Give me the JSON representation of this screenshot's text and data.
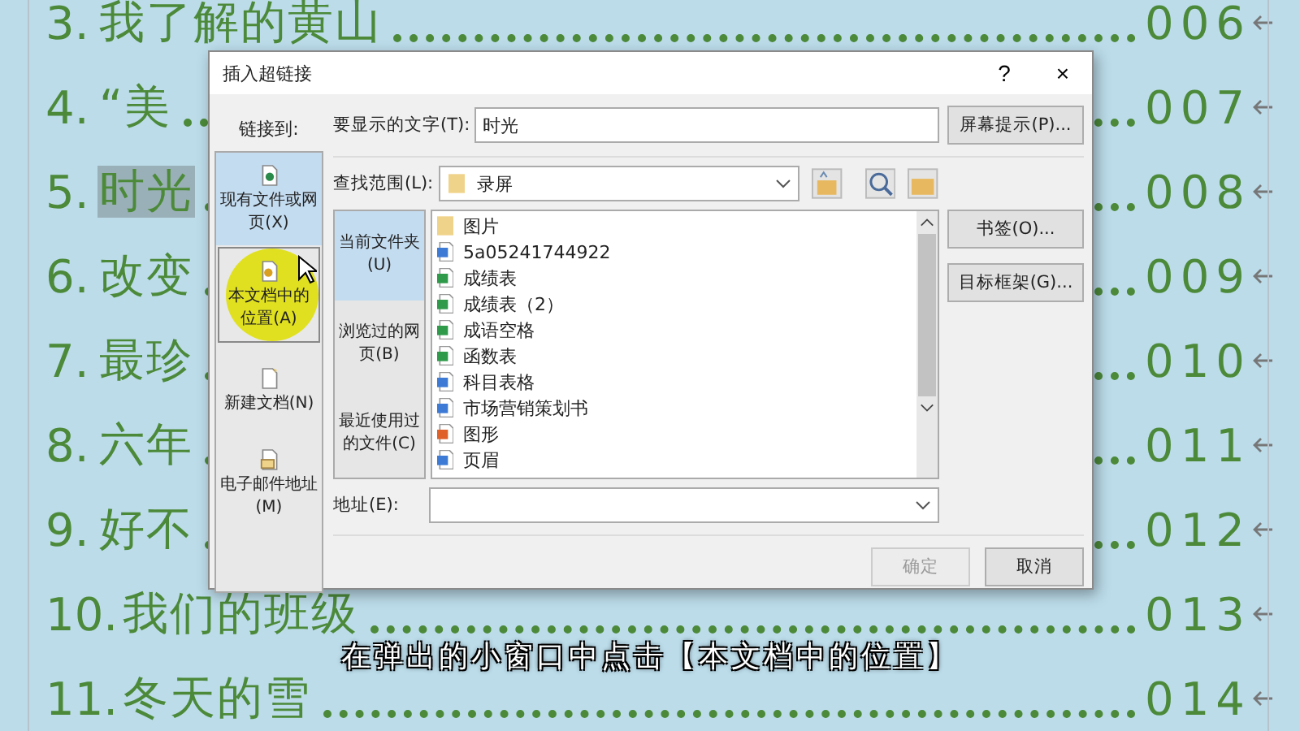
{
  "slide": {
    "rows": [
      {
        "number": "3.",
        "title": "我了解的黄山",
        "page": "006",
        "selected": false
      },
      {
        "number": "4.",
        "title": "“美",
        "page": "007",
        "selected": false
      },
      {
        "number": "5.",
        "title": "时光",
        "page": "008",
        "selected": true
      },
      {
        "number": "6.",
        "title": "改变",
        "page": "009",
        "selected": false
      },
      {
        "number": "7.",
        "title": "最珍",
        "page": "010",
        "selected": false
      },
      {
        "number": "8.",
        "title": "六年",
        "page": "011",
        "selected": false
      },
      {
        "number": "9.",
        "title": "好不",
        "page": "012",
        "selected": false
      },
      {
        "number": "10.",
        "title": "我们的班级",
        "page": "013",
        "selected": false
      },
      {
        "number": "11.",
        "title": "冬天的雪",
        "page": "014",
        "selected": false
      }
    ]
  },
  "dialog": {
    "title": "插入超链接",
    "help": "?",
    "close": "×",
    "link_to_label": "链接到:",
    "link_types": [
      {
        "label": "现有文件或网页(X)",
        "kind": "file",
        "selected": true
      },
      {
        "label": "本文档中的位置(A)",
        "kind": "place",
        "selected": false
      },
      {
        "label": "新建文档(N)",
        "kind": "new",
        "selected": false
      },
      {
        "label": "电子邮件地址(M)",
        "kind": "mail",
        "selected": false
      }
    ],
    "display_text": {
      "label": "要显示的文字(T):",
      "value": "时光"
    },
    "screen_tip_button": "屏幕提示(P)...",
    "look_in": {
      "label": "查找范围(L):",
      "value": "录屏"
    },
    "sources": [
      {
        "label": "当前文件夹(U)",
        "selected": true
      },
      {
        "label": "浏览过的网页(B)",
        "selected": false
      },
      {
        "label": "最近使用过的文件(C)",
        "selected": false
      }
    ],
    "files": [
      {
        "name": "图片",
        "kind": "folder"
      },
      {
        "name": "5a05241744922",
        "kind": "word"
      },
      {
        "name": "成绩表",
        "kind": "excel"
      },
      {
        "name": "成绩表（2）",
        "kind": "excel"
      },
      {
        "name": "成语空格",
        "kind": "excel"
      },
      {
        "name": "函数表",
        "kind": "excel"
      },
      {
        "name": "科目表格",
        "kind": "word"
      },
      {
        "name": "市场营销策划书",
        "kind": "word"
      },
      {
        "name": "图形",
        "kind": "ppt"
      },
      {
        "name": "页眉",
        "kind": "word"
      }
    ],
    "side_buttons": [
      "书签(O)...",
      "目标框架(G)..."
    ],
    "address": {
      "label": "地址(E):"
    },
    "buttons": [
      {
        "label": "确定",
        "disabled": true
      },
      {
        "label": "取消",
        "disabled": false
      }
    ]
  },
  "caption": "在弹出的小窗口中点击【本文档中的位置】"
}
